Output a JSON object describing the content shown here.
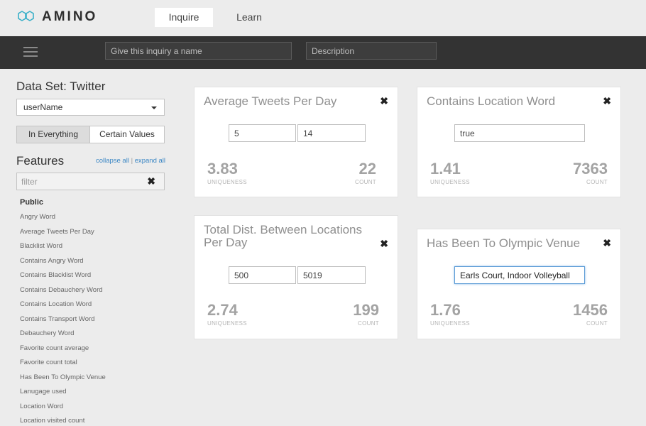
{
  "app": {
    "name": "AMINO",
    "brand_color": "#3ab0c8"
  },
  "nav": {
    "tabs": [
      {
        "label": "Inquire",
        "active": true
      },
      {
        "label": "Learn",
        "active": false
      }
    ]
  },
  "toolbar": {
    "menu_icon": "hamburger-icon",
    "name_placeholder": "Give this inquiry a name",
    "description_placeholder": "Description"
  },
  "sidebar": {
    "dataset_title": "Data Set: Twitter",
    "select_value": "userName",
    "segments": [
      {
        "label": "In Everything",
        "selected": true
      },
      {
        "label": "Certain Values",
        "selected": false
      }
    ],
    "features_title": "Features",
    "collapse_all": "collapse all",
    "expand_all": "expand all",
    "filter_placeholder": "filter",
    "group_label": "Public",
    "features": [
      "Angry Word",
      "Average Tweets Per Day",
      "Blacklist Word",
      "Contains Angry Word",
      "Contains Blacklist Word",
      "Contains Debauchery Word",
      "Contains Location Word",
      "Contains Transport Word",
      "Debauchery Word",
      "Favorite count average",
      "Favorite count total",
      "Has Been To Olympic Venue",
      "Lanugage used",
      "Location Word",
      "Location visited count"
    ]
  },
  "cards": [
    {
      "title": "Average Tweets Per Day",
      "inputs": [
        "5",
        "14"
      ],
      "uniqueness": "3.83",
      "count": "22",
      "uniqueness_label": "UNIQUENESS",
      "count_label": "COUNT"
    },
    {
      "title": "Contains Location Word",
      "inputs": [
        "true"
      ],
      "uniqueness": "1.41",
      "count": "7363",
      "uniqueness_label": "UNIQUENESS",
      "count_label": "COUNT"
    },
    {
      "title": "Total Dist. Between Locations Per Day",
      "inputs": [
        "500",
        "5019"
      ],
      "uniqueness": "2.74",
      "count": "199",
      "uniqueness_label": "UNIQUENESS",
      "count_label": "COUNT"
    },
    {
      "title": "Has Been To Olympic Venue",
      "inputs": [
        "Earls Court, Indoor Volleyball"
      ],
      "uniqueness": "1.76",
      "count": "1456",
      "uniqueness_label": "UNIQUENESS",
      "count_label": "COUNT"
    }
  ]
}
